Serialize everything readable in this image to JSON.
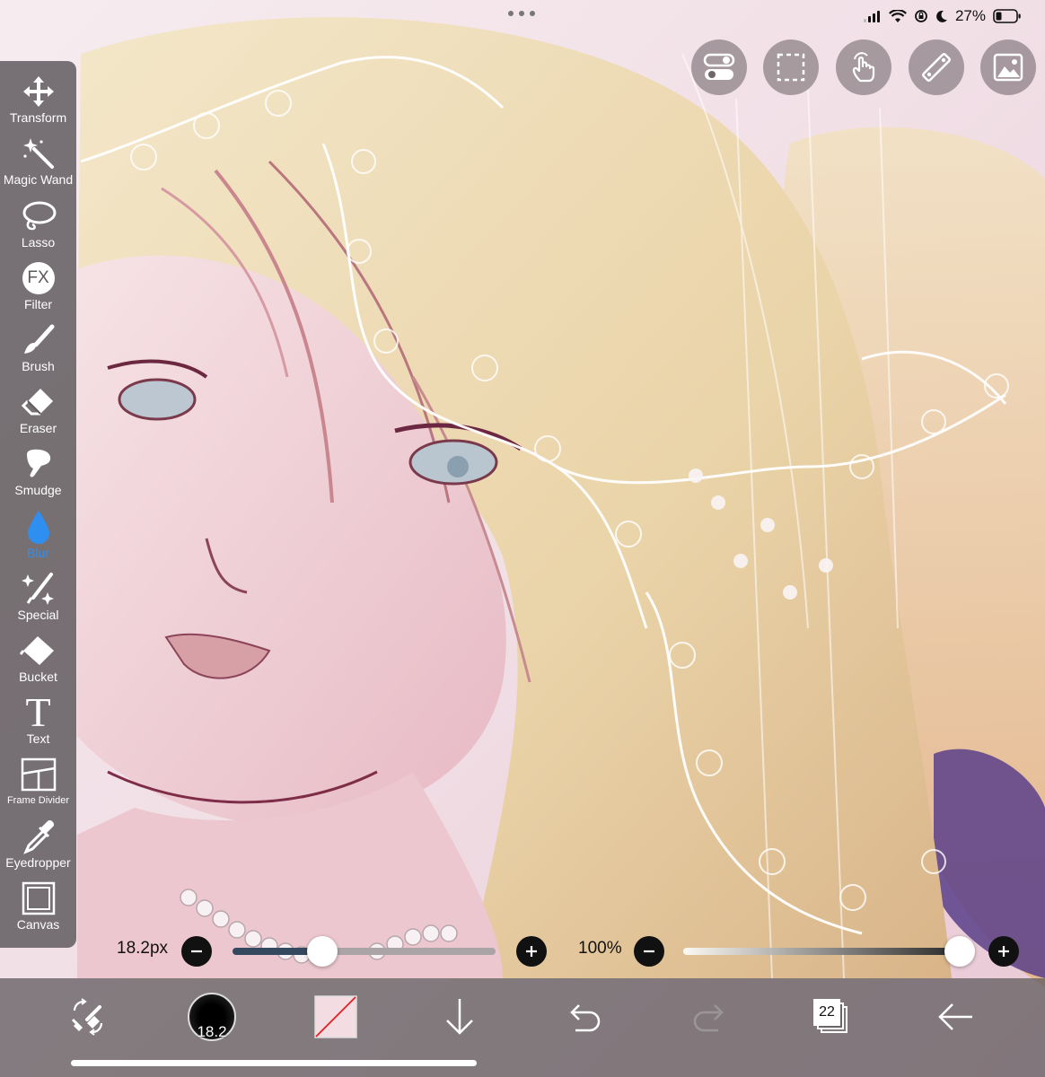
{
  "status_bar": {
    "battery": "27%"
  },
  "top_buttons": [
    {
      "icon": "toggle-settings-icon"
    },
    {
      "icon": "selection-rect-icon"
    },
    {
      "icon": "touch-hand-icon"
    },
    {
      "icon": "ruler-icon"
    },
    {
      "icon": "image-layer-icon"
    }
  ],
  "tools": [
    {
      "key": "transform",
      "label": "Transform",
      "icon": "move-arrows-icon"
    },
    {
      "key": "magic-wand",
      "label": "Magic Wand",
      "icon": "magic-wand-icon"
    },
    {
      "key": "lasso",
      "label": "Lasso",
      "icon": "lasso-icon"
    },
    {
      "key": "filter",
      "label": "Filter",
      "icon": "fx-icon",
      "glyph": "FX"
    },
    {
      "key": "brush",
      "label": "Brush",
      "icon": "brush-icon"
    },
    {
      "key": "eraser",
      "label": "Eraser",
      "icon": "eraser-icon"
    },
    {
      "key": "smudge",
      "label": "Smudge",
      "icon": "smudge-finger-icon"
    },
    {
      "key": "blur",
      "label": "Blur",
      "icon": "blur-drop-icon",
      "active": true
    },
    {
      "key": "special",
      "label": "Special",
      "icon": "special-sparkle-icon"
    },
    {
      "key": "bucket",
      "label": "Bucket",
      "icon": "bucket-icon"
    },
    {
      "key": "text",
      "label": "Text",
      "icon": "text-t-icon",
      "glyph": "T"
    },
    {
      "key": "frame-divider",
      "label": "Frame Divider",
      "icon": "frame-divider-icon"
    },
    {
      "key": "eyedropper",
      "label": "Eyedropper",
      "icon": "eyedropper-icon"
    },
    {
      "key": "canvas",
      "label": "Canvas",
      "icon": "canvas-square-icon"
    }
  ],
  "brush_size": {
    "label": "18.2px",
    "fraction": 0.34
  },
  "opacity": {
    "label": "100%",
    "fraction": 1.0
  },
  "bottom_bar": {
    "brush_preview_value": "18.2",
    "layers_count": "22"
  },
  "colors": {
    "active_tool": "#2f8ff0",
    "toolbar_bg": "#5f5a5d",
    "size_track": "#34495e"
  }
}
